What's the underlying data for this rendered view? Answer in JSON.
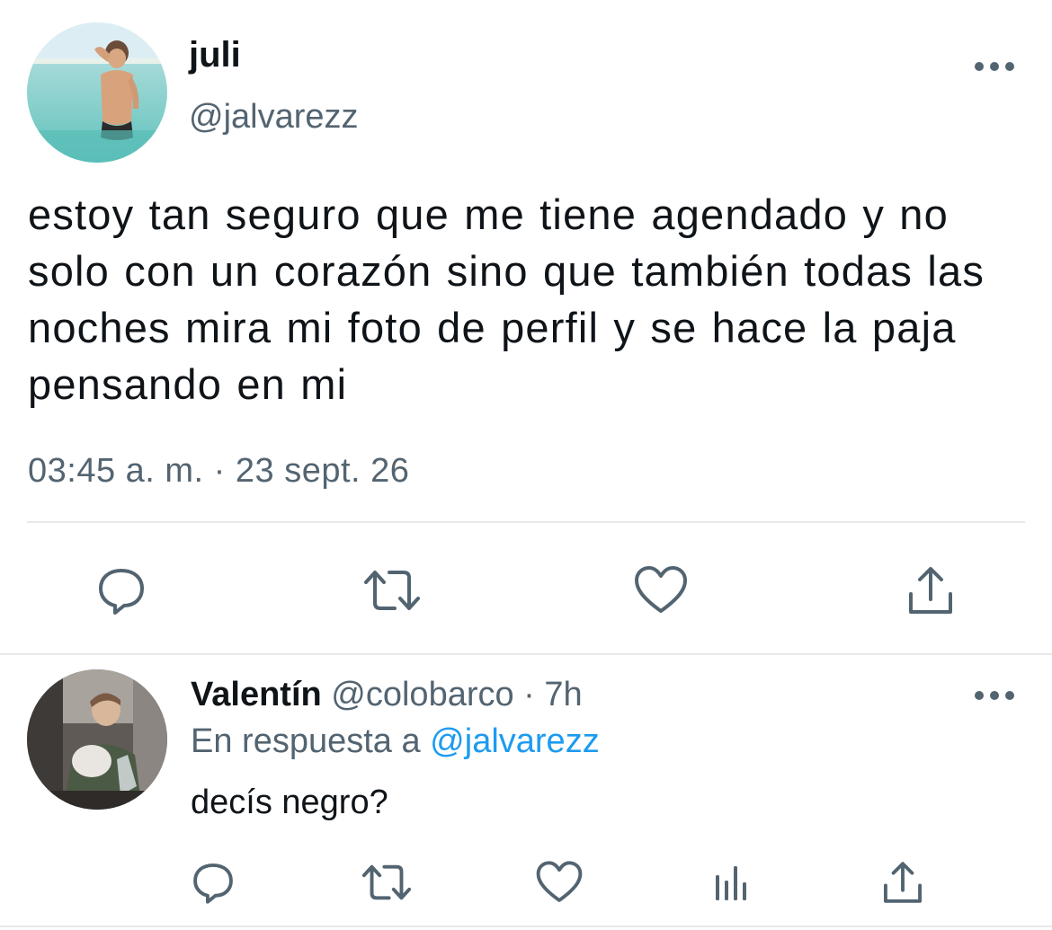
{
  "main_tweet": {
    "name": "juli",
    "handle": "@jalvarezz",
    "text": "estoy tan seguro que me tiene agendado y no solo con un corazón sino que también todas las noches mira mi foto de perfil y se hace la paja pensando en mi",
    "timestamp": "03:45 a. m. · 23 sept. 26",
    "actions": [
      "reply-icon",
      "retweet-icon",
      "like-icon",
      "share-icon"
    ]
  },
  "reply_tweet": {
    "name": "Valentín",
    "handle": "@colobarco",
    "time_separator": " · ",
    "time": "7h",
    "replying_to_label": "En respuesta a ",
    "replying_to_handle": "@jalvarezz",
    "text": "decís negro?",
    "actions": [
      "reply-icon",
      "retweet-icon",
      "like-icon",
      "analytics-icon",
      "share-icon"
    ]
  },
  "colors": {
    "text": "#0f1419",
    "secondary": "#536471",
    "link": "#1d9bf0",
    "divider": "#e6e8ea"
  }
}
